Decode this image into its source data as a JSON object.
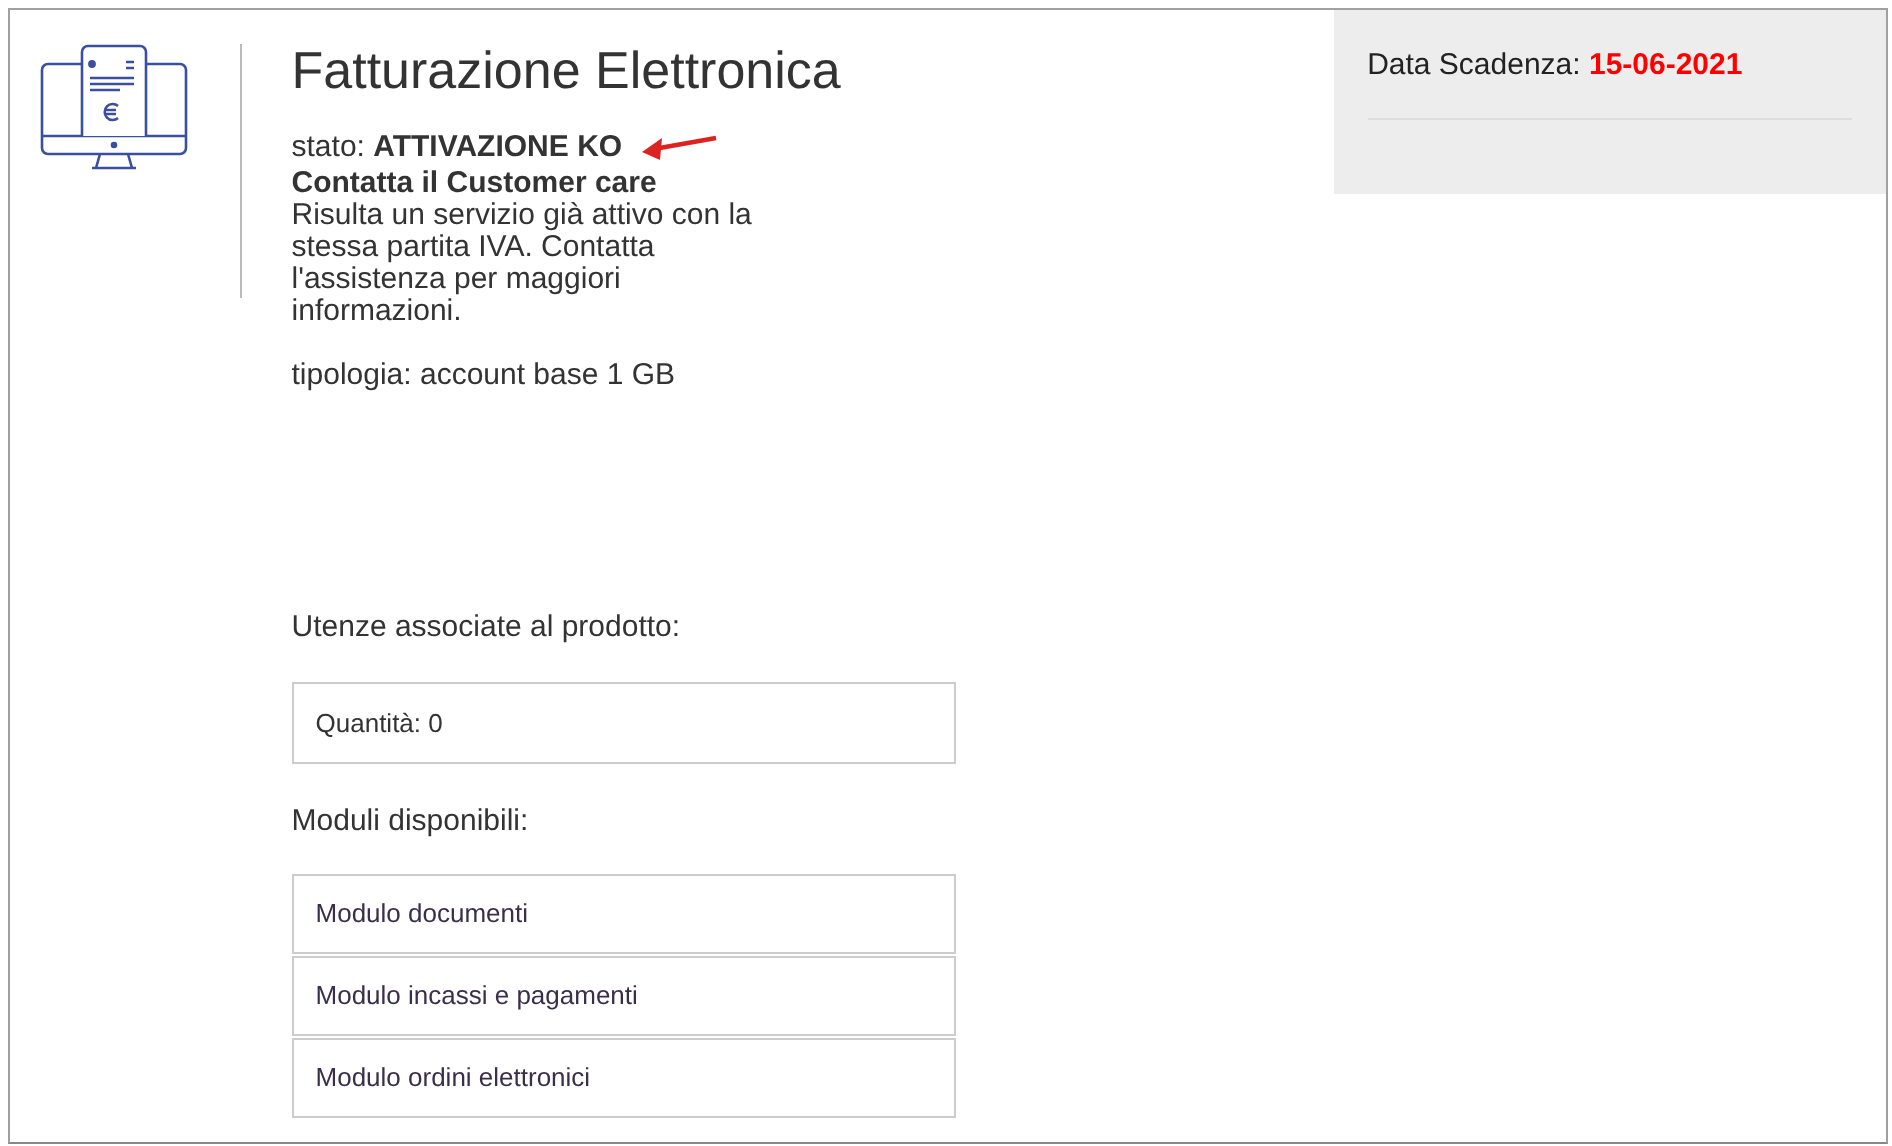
{
  "product": {
    "title": "Fatturazione Elettronica",
    "status_label": "stato:",
    "status_value": "ATTIVAZIONE KO",
    "message_title": "Contatta il Customer care",
    "message_body": "Risulta un servizio già attivo con la stessa partita IVA. Contatta l'assistenza per maggiori informazioni.",
    "type_line": "tipologia: account base 1 GB"
  },
  "expiry": {
    "label": "Data Scadenza:",
    "date": "15-06-2021"
  },
  "users": {
    "heading": "Utenze associate al prodotto:",
    "quantity": "Quantità: 0"
  },
  "modules": {
    "heading": "Moduli disponibili:",
    "items": [
      "Modulo documenti",
      "Modulo incassi e pagamenti",
      "Modulo ordini elettronici"
    ]
  }
}
